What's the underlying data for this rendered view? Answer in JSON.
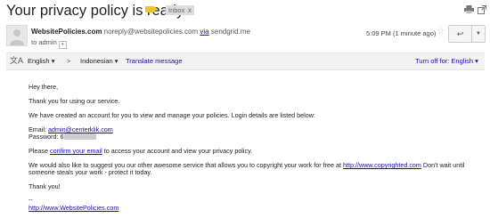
{
  "email": {
    "subject": "Your privacy policy is ready",
    "label_inbox": "Inbox",
    "label_remove": "x",
    "sender_name": "WebsitePolicies.com",
    "sender_email": "noreply@websitepolicies.com",
    "via_label": "via",
    "via_domain": "sendgrid.me",
    "to_line": "to admin",
    "time": "5:09 PM (1 minute ago)"
  },
  "translate": {
    "source": "English",
    "arrow": ">",
    "target": "Indonesian",
    "action": "Translate message",
    "turn_off": "Turn off for: English"
  },
  "body": {
    "greeting": "Hey there,",
    "thanks": "Thank you for using our service.",
    "created": "We have created an account for you to view and manage your policies. Login details are listed below:",
    "email_label": "Email:",
    "email_value": "admin@centerklik.com",
    "password_label": "Password:",
    "password_value": "6",
    "confirm_pre": "Please",
    "confirm_link": "confirm your email",
    "confirm_post": "to access your account and view your privacy policy.",
    "suggest_pre": "We would also like to suggest you our other awesome service that allows you to copyright your work for free at",
    "suggest_link": "http://www.copyrighted.com",
    "suggest_post": "Don't wait until",
    "suggest_line2": "someone steals your work - protect it today.",
    "thank_you": "Thank you!",
    "sig_dashes": "--",
    "sig_link": "http://www.WebsitePolicies.com"
  },
  "icons": {
    "tag": "label-tag-icon",
    "print": "print-icon",
    "new_window": "new-window-icon",
    "star": "star-icon",
    "reply": "reply-icon",
    "more": "more-options-icon",
    "translate": "translate-icon"
  },
  "colors": {
    "link": "#1a0dab",
    "tag": "#f4c12d"
  }
}
